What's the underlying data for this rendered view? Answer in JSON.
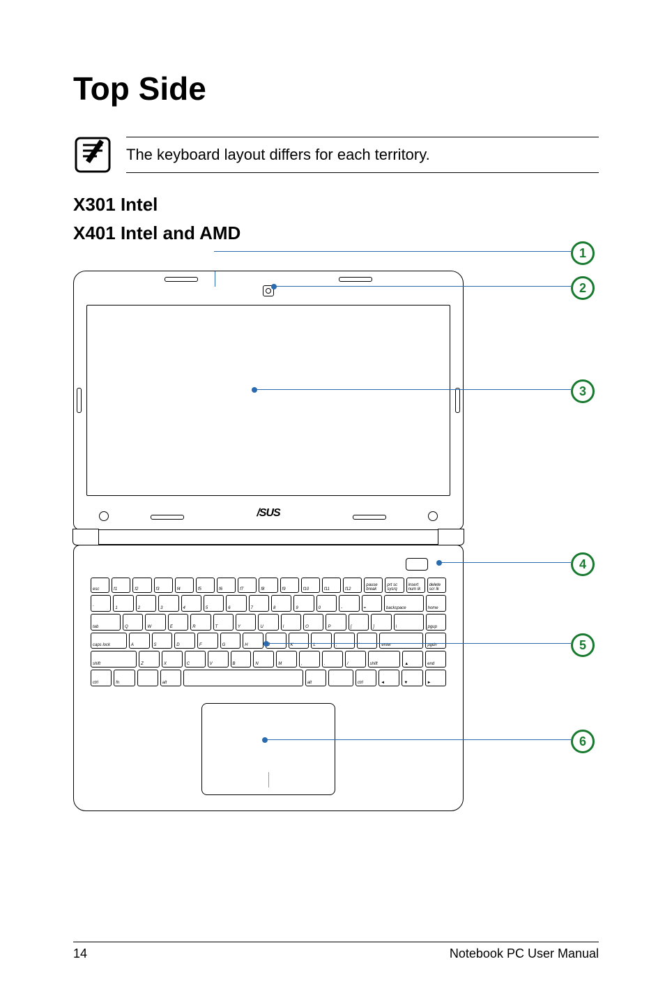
{
  "page": {
    "title": "Top Side",
    "note": "The keyboard layout differs for each territory.",
    "sub1": "X301 Intel",
    "sub2": "X401 Intel and AMD",
    "logo": "/SUS",
    "number": "14",
    "footer": "Notebook PC User Manual"
  },
  "callouts": {
    "c1": "1",
    "c2": "2",
    "c3": "3",
    "c4": "4",
    "c5": "5",
    "c6": "6"
  },
  "keys": {
    "r0": [
      "esc",
      "f1",
      "f2",
      "f3",
      "f4",
      "f5",
      "f6",
      "f7",
      "f8",
      "f9",
      "f10",
      "f11",
      "f12",
      "pause break",
      "prt sc sysrq",
      "insert num lk",
      "delete scr lk"
    ],
    "r1": [
      "`",
      "1",
      "2",
      "3",
      "4",
      "5",
      "6",
      "7",
      "8",
      "9",
      "0",
      "-",
      "=",
      "backspace",
      "home"
    ],
    "r2": [
      "tab",
      "Q",
      "W",
      "E",
      "R",
      "T",
      "Y",
      "U",
      "I",
      "O",
      "P",
      "[",
      "]",
      "\\",
      "pgup"
    ],
    "r3": [
      "caps lock",
      "A",
      "S",
      "D",
      "F",
      "G",
      "H",
      "J",
      "K",
      "L",
      ";",
      "'",
      "enter",
      "pgdn"
    ],
    "r4": [
      "shift",
      "Z",
      "X",
      "C",
      "V",
      "B",
      "N",
      "M",
      ",",
      ".",
      "/",
      "shift",
      "▲",
      "end"
    ],
    "r5": [
      "ctrl",
      "fn",
      "",
      "alt",
      "",
      "alt",
      "",
      "ctrl",
      "◄",
      "▼",
      "►"
    ]
  }
}
